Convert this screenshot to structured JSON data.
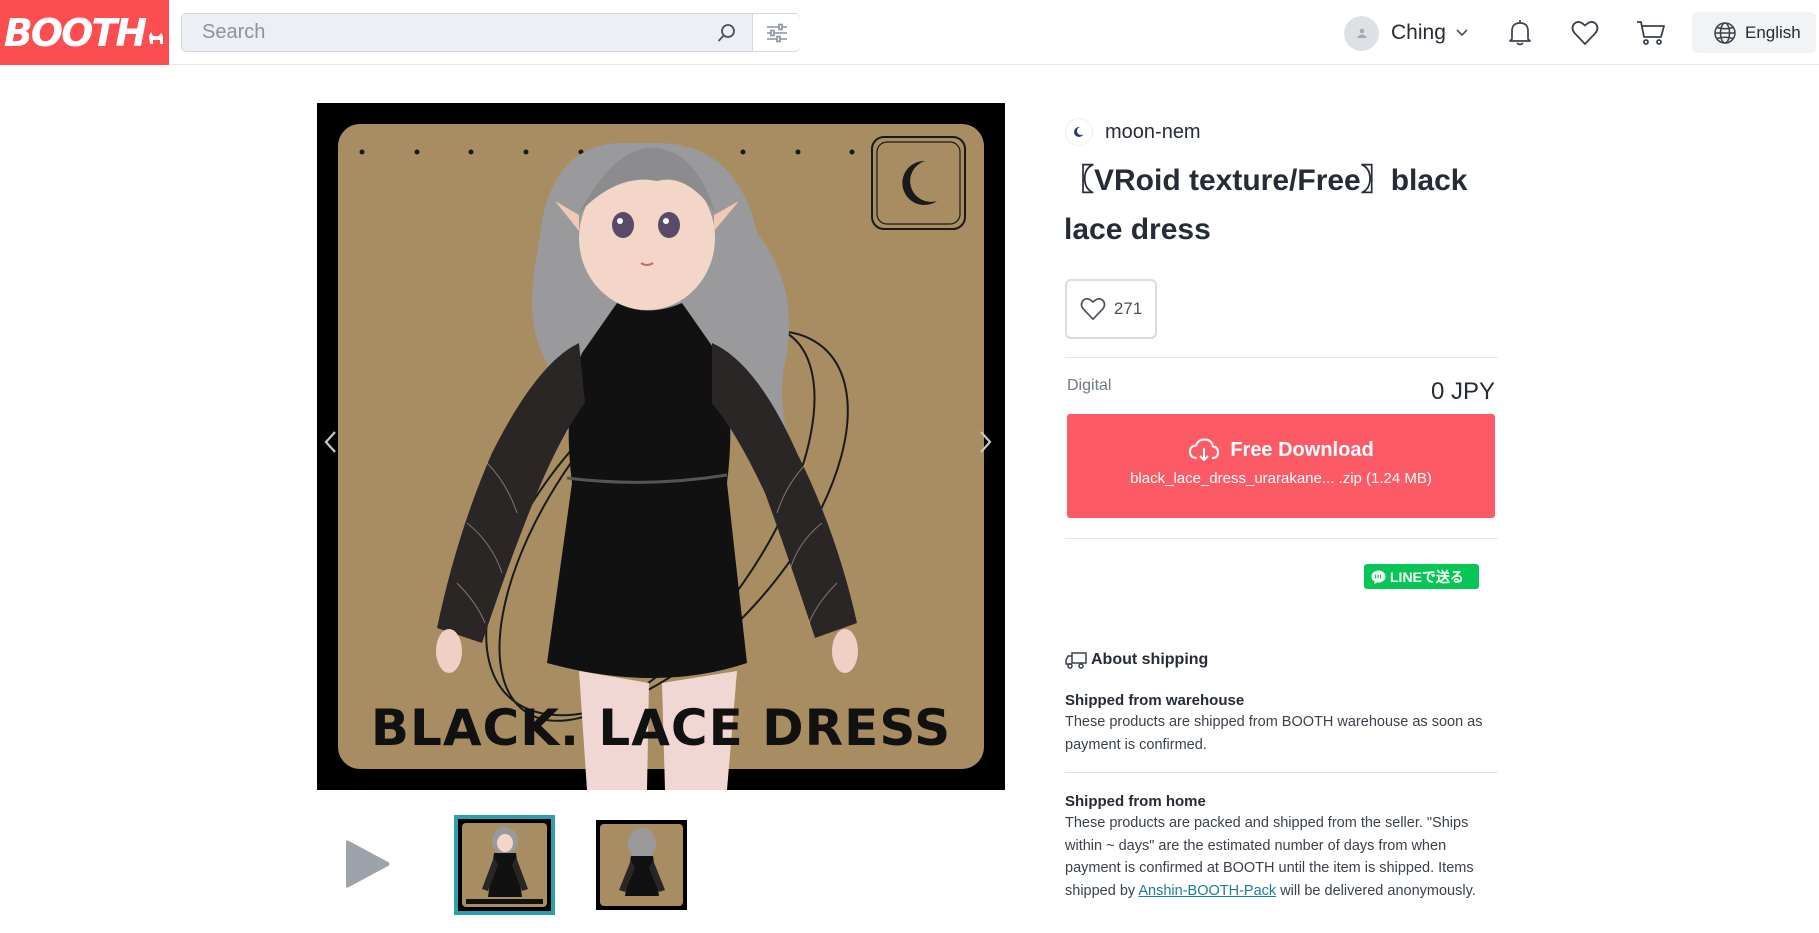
{
  "header": {
    "logo_text": "BOOTH",
    "search_placeholder": "Search",
    "user_name": "Ching",
    "language": "English"
  },
  "product": {
    "shop_name": "moon-nem",
    "title": "〖VRoid texture/Free〗black lace dress",
    "likes": "271",
    "image_caption": "BLACK. LACE DRESS",
    "variant": {
      "label": "Digital",
      "price": "0 JPY",
      "download_label": "Free Download",
      "file": "black_lace_dress_urarakane... .zip (1.24 MB)"
    },
    "line_share": "LINEで送る"
  },
  "shipping": {
    "heading": "About shipping",
    "warehouse_title": "Shipped from warehouse",
    "warehouse_text": "These products are shipped from BOOTH warehouse as soon as payment is confirmed.",
    "home_title": "Shipped from home",
    "home_text": "These products are packed and shipped from the seller. \"Ships within ~ days\" are the estimated number of days from when payment is confirmed at BOOTH until the item is shipped.",
    "pack_prefix": "Items shipped by ",
    "pack_link": "Anshin-BOOTH-Pack",
    "pack_suffix": " will be delivered anonymously."
  },
  "colors": {
    "brand": "#fc4d50",
    "download": "#fc5b66",
    "line": "#06c755",
    "thumb_border": "#2e9fae",
    "image_bg": "#a88c62"
  },
  "icons": [
    "search-icon",
    "filter-icon",
    "chevron-down-icon",
    "bell-icon",
    "heart-icon",
    "cart-icon",
    "globe-icon",
    "cloud-download-icon",
    "truck-icon",
    "play-icon",
    "chevron-left-icon",
    "chevron-right-icon",
    "line-icon"
  ]
}
